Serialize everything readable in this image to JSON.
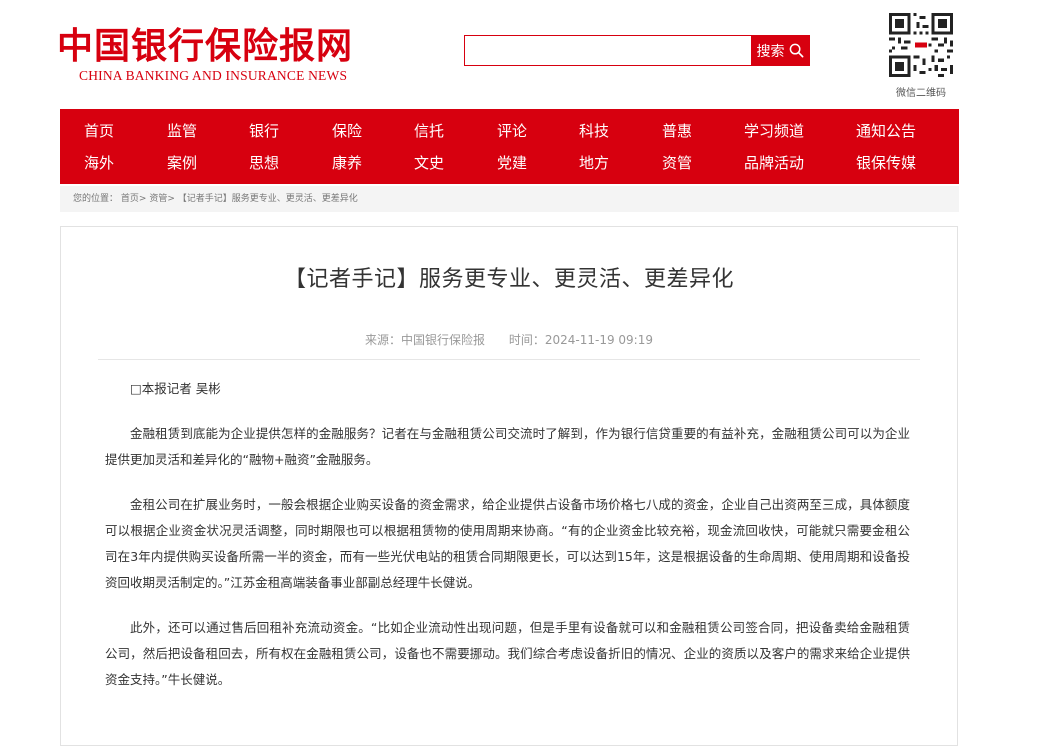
{
  "header": {
    "logo_cn": "中国银行保险报网",
    "logo_en": "CHINA BANKING AND INSURANCE NEWS",
    "search": {
      "placeholder": "",
      "button_label": "搜索"
    },
    "qr_caption": "微信二维码"
  },
  "nav": {
    "row1": [
      "首页",
      "监管",
      "银行",
      "保险",
      "信托",
      "评论",
      "科技",
      "普惠",
      "学习频道",
      "通知公告"
    ],
    "row2": [
      "海外",
      "案例",
      "思想",
      "康养",
      "文史",
      "党建",
      "地方",
      "资管",
      "品牌活动",
      "银保传媒"
    ]
  },
  "breadcrumb": {
    "prefix": "您的位置：",
    "home": "首页",
    "section": "资管",
    "sep": ">",
    "current": "【记者手记】服务更专业、更灵活、更差异化"
  },
  "article": {
    "title": "【记者手记】服务更专业、更灵活、更差异化",
    "source": "来源：中国银行保险报",
    "time": "时间：2024-11-19 09:19",
    "paragraphs": [
      "□本报记者 吴彬",
      "金融租赁到底能为企业提供怎样的金融服务？记者在与金融租赁公司交流时了解到，作为银行信贷重要的有益补充，金融租赁公司可以为企业提供更加灵活和差异化的“融物+融资”金融服务。",
      "金租公司在扩展业务时，一般会根据企业购买设备的资金需求，给企业提供占设备市场价格七八成的资金，企业自己出资两至三成，具体额度可以根据企业资金状况灵活调整，同时期限也可以根据租赁物的使用周期来协商。“有的企业资金比较充裕，现金流回收快，可能就只需要金租公司在3年内提供购买设备所需一半的资金，而有一些光伏电站的租赁合同期限更长，可以达到15年，这是根据设备的生命周期、使用周期和设备投资回收期灵活制定的。”江苏金租高端装备事业部副总经理牛长健说。",
      "此外，还可以通过售后回租补充流动资金。“比如企业流动性出现问题，但是手里有设备就可以和金融租赁公司签合同，把设备卖给金融租赁公司，然后把设备租回去，所有权在金融租赁公司，设备也不需要挪动。我们综合考虑设备折旧的情况、企业的资质以及客户的需求来给企业提供资金支持。”牛长健说。"
    ]
  },
  "colors": {
    "brand_red": "#d7000f",
    "crumb_bg": "#f4f4f4"
  },
  "icons": {
    "search": "search-icon",
    "qr": "qr-code-icon"
  }
}
